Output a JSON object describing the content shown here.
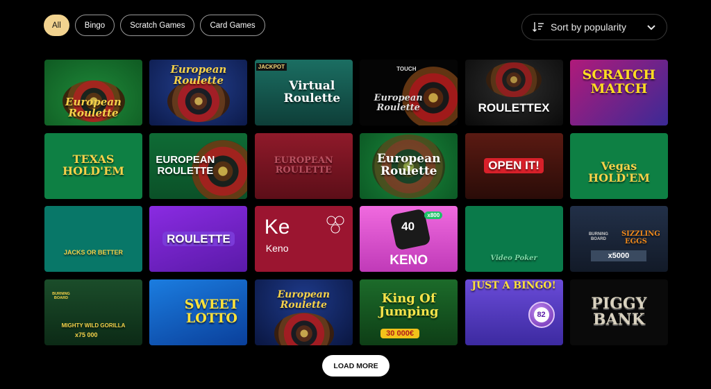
{
  "filters": [
    {
      "label": "All",
      "active": true
    },
    {
      "label": "Bingo",
      "active": false
    },
    {
      "label": "Scratch Games",
      "active": false
    },
    {
      "label": "Card Games",
      "active": false
    }
  ],
  "sort": {
    "label": "Sort by popularity",
    "icon": "sort-icon"
  },
  "games": [
    {
      "title": "European Roulette"
    },
    {
      "title": "European Roulette"
    },
    {
      "title": "Virtual Roulette",
      "badge": "JACKPOT"
    },
    {
      "title": "European Roulette",
      "badge": "TOUCH"
    },
    {
      "title": "ROULETTEX"
    },
    {
      "title": "SCRATCH MATCH"
    },
    {
      "title": "TEXAS HOLD'EM"
    },
    {
      "title": "EUROPEAN ROULETTE"
    },
    {
      "title": "EUROPEAN ROULETTE"
    },
    {
      "title": "European Roulette"
    },
    {
      "title": "OPEN IT!"
    },
    {
      "title": "Vegas HOLD'EM"
    },
    {
      "title": "JACKS OR BETTER"
    },
    {
      "title": "ROULETTE"
    },
    {
      "title": "Keno",
      "ke": "Ke"
    },
    {
      "title": "KENO",
      "small": "40",
      "tag": "x800"
    },
    {
      "title": "Video Poker"
    },
    {
      "title": "SIZZLING EGGS",
      "sub": "x5000",
      "brand": "BURNING BOARD"
    },
    {
      "title": "MIGHTY WILD GORILLA",
      "sub": "x75 000",
      "brand": "BURNING BOARD"
    },
    {
      "title": "SWEET LOTTO"
    },
    {
      "title": "European Roulette"
    },
    {
      "title": "King Of Jumping",
      "sub": "30 000€"
    },
    {
      "title": "JUST A BINGO!",
      "ball": "82"
    },
    {
      "title": "PIGGY BANK"
    }
  ],
  "load_more": {
    "label": "LOAD MORE"
  }
}
